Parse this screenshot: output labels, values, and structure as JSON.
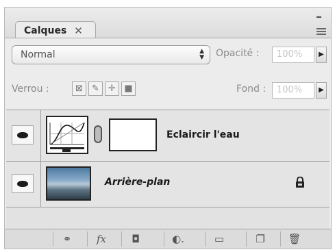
{
  "panel": {
    "tab_label": "Calques",
    "close_glyph": "✕",
    "minimize_glyph": "–"
  },
  "blend": {
    "mode": "Normal",
    "opacity_label": "Opacité :",
    "opacity_value": "100%",
    "lock_label": "Verrou :",
    "fill_label": "Fond :",
    "fill_value": "100%"
  },
  "layers": [
    {
      "name": "Eclaircir l'eau",
      "type": "adjustment-curves",
      "visible": true
    },
    {
      "name": "Arrière-plan",
      "type": "background",
      "visible": true,
      "locked": true
    }
  ],
  "footer_buttons": [
    "link-icon",
    "fx-icon",
    "mask-icon",
    "adjustment-icon",
    "folder-icon",
    "new-layer-icon",
    "trash-icon"
  ],
  "colors": {
    "panel_bg": "#ececec",
    "border": "#a0a0a0"
  }
}
